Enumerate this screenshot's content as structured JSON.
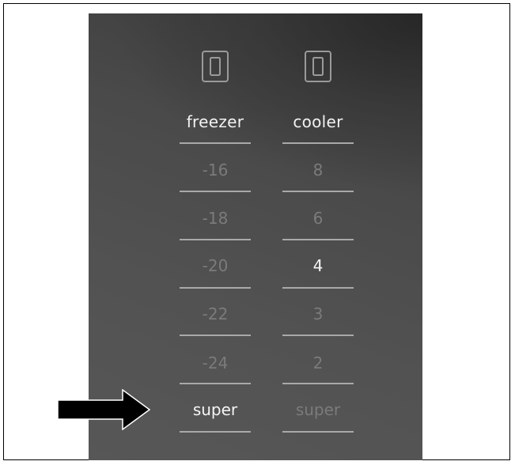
{
  "panel": {
    "freezer": {
      "title": "freezer",
      "icon": "fridge-door-icon",
      "settings": [
        "-16",
        "-18",
        "-20",
        "-22",
        "-24",
        "super"
      ],
      "active_setting": "super"
    },
    "cooler": {
      "title": "cooler",
      "icon": "fridge-door-icon",
      "settings": [
        "8",
        "6",
        "4",
        "3",
        "2",
        "super"
      ],
      "active_setting": "4"
    }
  },
  "pointer": {
    "icon": "arrow-right-icon",
    "target": "freezer super"
  },
  "colors": {
    "panel_background": "#4a4a4a",
    "active_text": "#f5f5f5",
    "inactive_text": "#7b7b7b",
    "divider": "#a9a9a9",
    "arrow_fill": "#000000",
    "arrow_outline": "#ffffff"
  }
}
